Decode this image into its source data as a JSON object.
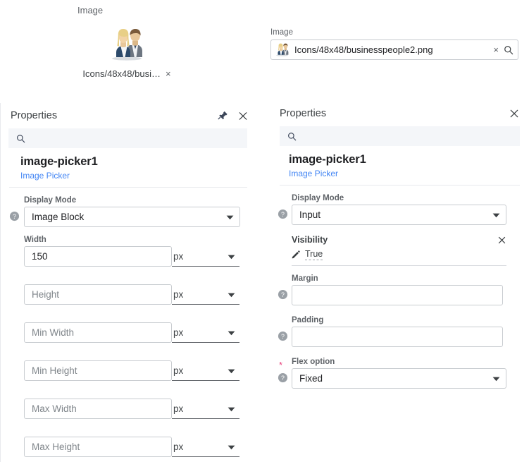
{
  "preview": {
    "label": "Image",
    "thumb_icon": "businesspeople-icon",
    "filename": "Icons/48x48/busi…",
    "clear": "×"
  },
  "image_field": {
    "label": "Image",
    "value": "Icons/48x48/businesspeople2.png",
    "thumb_icon": "businesspeople-icon",
    "clear": "×",
    "search_icon": "search-icon"
  },
  "colors": {
    "link": "#4285f4",
    "required": "#e8457f",
    "search_bg": "#f4f6f9",
    "border": "#c8ccd0"
  },
  "left_panel": {
    "title": "Properties",
    "pin_icon": "pin-icon",
    "close_icon": "close-icon",
    "search_icon": "search-icon",
    "search_placeholder": "",
    "object_name": "image-picker1",
    "object_type": "Image Picker",
    "display_mode": {
      "label": "Display Mode",
      "value": "Image Block",
      "help_icon": "help-icon",
      "caret_icon": "chevron-down-icon"
    },
    "size_fields": [
      {
        "label": "Width",
        "value": "150",
        "placeholder": "Width",
        "unit": "px"
      },
      {
        "label": "",
        "value": "",
        "placeholder": "Height",
        "unit": "px"
      },
      {
        "label": "",
        "value": "",
        "placeholder": "Min Width",
        "unit": "px"
      },
      {
        "label": "",
        "value": "",
        "placeholder": "Min Height",
        "unit": "px"
      },
      {
        "label": "",
        "value": "",
        "placeholder": "Max Width",
        "unit": "px"
      },
      {
        "label": "",
        "value": "",
        "placeholder": "Max Height",
        "unit": "px"
      }
    ]
  },
  "right_panel": {
    "title": "Properties",
    "close_icon": "close-icon",
    "search_icon": "search-icon",
    "search_placeholder": "",
    "object_name": "image-picker1",
    "object_type": "Image Picker",
    "display_mode": {
      "label": "Display Mode",
      "value": "Input",
      "help_icon": "help-icon",
      "caret_icon": "chevron-down-icon"
    },
    "visibility": {
      "label": "Visibility",
      "value": "True",
      "edit_icon": "pencil-icon",
      "close_icon": "close-icon"
    },
    "margin": {
      "label": "Margin",
      "value": "",
      "placeholder": "",
      "help_icon": "help-icon"
    },
    "padding": {
      "label": "Padding",
      "value": "",
      "placeholder": "",
      "help_icon": "help-icon"
    },
    "flex_option": {
      "label": "Flex option",
      "value": "Fixed",
      "required_marker": "*",
      "help_icon": "help-icon",
      "caret_icon": "chevron-down-icon"
    }
  }
}
